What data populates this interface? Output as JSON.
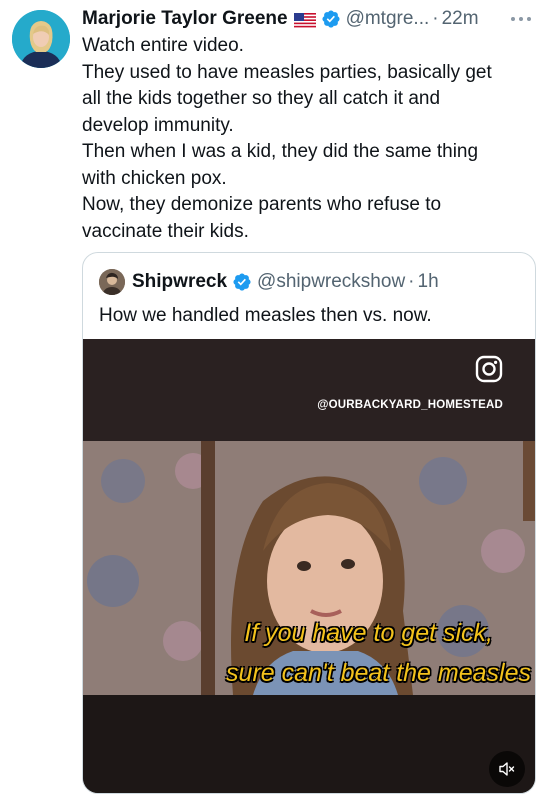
{
  "tweet": {
    "author_name": "Marjorie Taylor Greene",
    "handle": "@mtgre...",
    "separator": "·",
    "time": "22m",
    "flag_icon": "us-flag-icon",
    "verified_icon": "verified-badge-icon",
    "text_lines": [
      "Watch entire video.",
      "They used to have measles parties, basically get",
      "all the kids together so they all catch it and",
      "develop immunity.",
      "Then when I was a kid, they did the same thing",
      "with chicken pox.",
      "Now, they demonize parents who refuse to",
      "vaccinate their kids."
    ]
  },
  "quote": {
    "author_name": "Shipwreck",
    "handle": "@shipwreckshow",
    "separator": "·",
    "time": "1h",
    "text": "How we handled measles then vs. now.",
    "video": {
      "watermark": "@OURBACKYARD_HOMESTEAD",
      "caption_line1": "If you have to get sick,",
      "caption_line2": "sure can't beat the measles"
    }
  },
  "colors": {
    "text_primary": "#0f1419",
    "text_secondary": "#536471",
    "verified_blue": "#1d9bf0",
    "border": "#cfd9de",
    "caption_yellow": "#f3c21c"
  }
}
